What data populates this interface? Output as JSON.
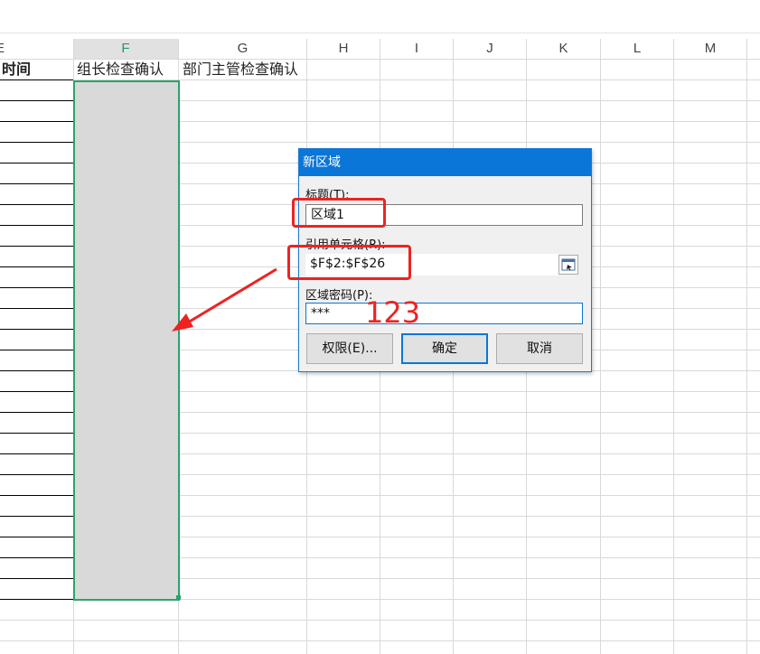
{
  "columns": {
    "E": "E",
    "F": "F",
    "G": "G",
    "H": "H",
    "I": "I",
    "J": "J",
    "K": "K",
    "L": "L",
    "M": "M"
  },
  "cells": {
    "e1": "时间",
    "f1": "组长检查确认",
    "g1": "部门主管检查确认"
  },
  "dialog": {
    "title": "新区域",
    "title_label": "标题(T):",
    "title_value": "区域1",
    "ref_label": "引用单元格(R):",
    "ref_value": "$F$2:$F$26",
    "password_label": "区域密码(P):",
    "password_value": "***",
    "permissions_button": "权限(E)...",
    "ok_button": "确定",
    "cancel_button": "取消"
  },
  "annotation": {
    "password_hint": "123"
  },
  "colors": {
    "selection_border": "#2aa36b",
    "dialog_titlebar": "#0a76d8",
    "annotation_red": "#ee2222"
  }
}
